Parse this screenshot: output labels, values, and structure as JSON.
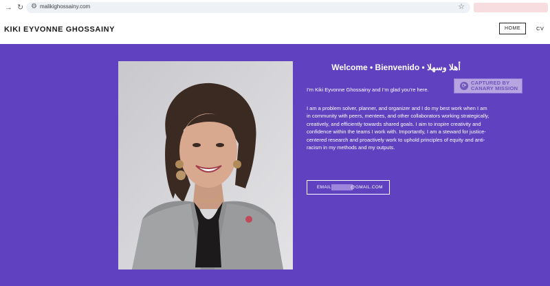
{
  "browser": {
    "url": "malikighossainy.com",
    "icons": [
      "arrow-forward-icon",
      "reload-icon",
      "site-info-icon",
      "bookmark-star-icon"
    ]
  },
  "header": {
    "site_title": "KIKI EYVONNE GHOSSAINY",
    "nav": {
      "home": "HOME",
      "cv": "CV"
    }
  },
  "main": {
    "welcome": "Welcome • Bienvenido • أهلا وسهلا",
    "intro": "I’m Kiki Eyvonne Ghossainy and I’m glad you’re here.",
    "bio": "I am a problem solver, planner, and organizer and I do my best work when I am in community with peers, mentees, and other collaborators working strategically, creatively, and efficiently towards shared goals. I aim to inspire creativity and confidence within the teams I work with. Importantly, I am a steward for justice-centered research and proactively work to uphold principles of equity and anti-racism in my methods and my outputs.",
    "email_prefix": "EMAIL:",
    "email_suffix": "@GMAIL.COM"
  },
  "watermark": {
    "line1": "CAPTURED BY",
    "line2": "CANARY MISSION"
  },
  "colors": {
    "background": "#6041bf",
    "header": "#ffffff",
    "text_on_bg": "#ffffff",
    "watermark": "#b6a5e0"
  }
}
